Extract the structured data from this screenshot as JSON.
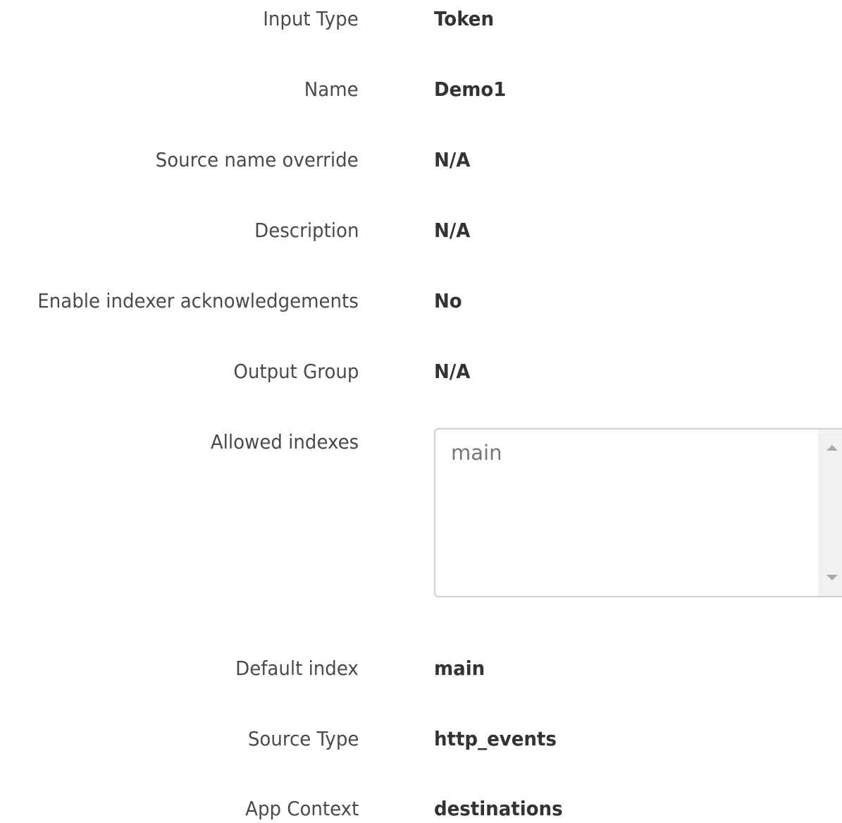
{
  "fields": {
    "input_type": {
      "label": "Input Type",
      "value": "Token"
    },
    "name": {
      "label": "Name",
      "value": "Demo1"
    },
    "source_name_override": {
      "label": "Source name override",
      "value": "N/A"
    },
    "description": {
      "label": "Description",
      "value": "N/A"
    },
    "indexer_ack": {
      "label": "Enable indexer acknowledgements",
      "value": "No"
    },
    "output_group": {
      "label": "Output Group",
      "value": "N/A"
    },
    "allowed_indexes": {
      "label": "Allowed indexes",
      "items": [
        "main"
      ]
    },
    "default_index": {
      "label": "Default index",
      "value": "main"
    },
    "source_type": {
      "label": "Source Type",
      "value": "http_events"
    },
    "app_context": {
      "label": "App Context",
      "value": "destinations"
    }
  },
  "icons": {
    "scroll_up": "triangle-up",
    "scroll_down": "triangle-down"
  },
  "colors": {
    "label": "#4a4a4a",
    "value": "#333333",
    "listbox_border": "#cfcfcf",
    "listbox_item": "#777777"
  }
}
